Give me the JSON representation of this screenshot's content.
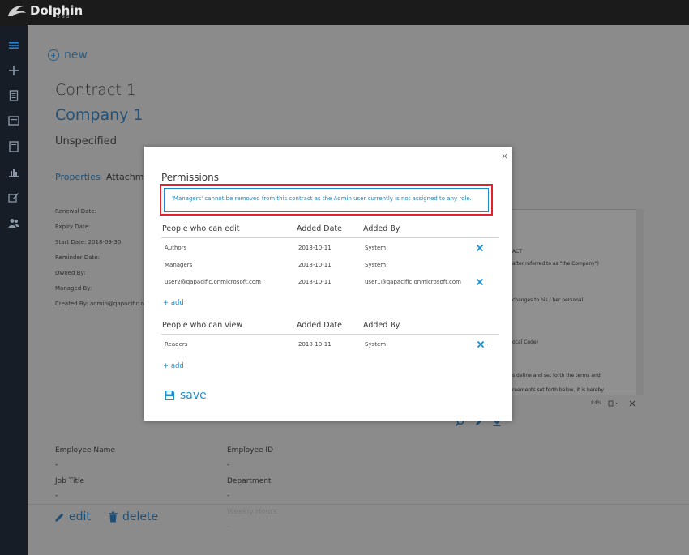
{
  "app": {
    "name": "Dolphin",
    "sub": "365"
  },
  "sidebar": {
    "icons": [
      "menu-icon",
      "plus-icon",
      "document-icon",
      "inbox-icon",
      "report-icon",
      "chart-icon",
      "edit-icon",
      "users-icon"
    ]
  },
  "page": {
    "new_label": "new",
    "contract_title": "Contract 1",
    "company": "Company 1",
    "status": "Unspecified",
    "tabs": [
      "Properties",
      "Attachments"
    ],
    "meta": [
      "Renewal Date:",
      "Expiry Date:",
      "Start Date: 2018-09-30",
      "Reminder Date:",
      "Owned By:",
      "Managed By:",
      "Created By: admin@qapacific.onmicrosoft.com"
    ],
    "doc_lines": [
      "ACT",
      "after referred to as \"the Company\")",
      "changes to his / her personal",
      "ocal Code)",
      "s define and set forth the terms and",
      "reements set forth below, it is hereby"
    ],
    "doc_zoom": "84%",
    "fields": {
      "employee_name": "Employee Name",
      "employee_name_val": "-",
      "employee_id": "Employee ID",
      "employee_id_val": "-",
      "job_title": "Job Title",
      "job_title_val": "-",
      "department": "Department",
      "department_val": "-",
      "hidden_label": "Weekly Hours",
      "hidden_val": "-"
    },
    "edit_label": "edit",
    "delete_label": "delete"
  },
  "modal": {
    "close": "×",
    "title": "Permissions",
    "warning": "'Managers' cannot be removed from this contract as the Admin user currently is not assigned to any role.",
    "edit_section": {
      "header": "People who can edit",
      "col_date": "Added Date",
      "col_by": "Added By",
      "rows": [
        {
          "name": "Authors",
          "date": "2018-10-11",
          "by": "System",
          "removable": true
        },
        {
          "name": "Managers",
          "date": "2018-10-11",
          "by": "System",
          "removable": false
        },
        {
          "name": "user2@qapacific.onmicrosoft.com",
          "date": "2018-10-11",
          "by": "user1@qapacific.onmicrosoft.com",
          "removable": true
        }
      ],
      "add": "+ add"
    },
    "view_section": {
      "header": "People who can view",
      "col_date": "Added Date",
      "col_by": "Added By",
      "rows": [
        {
          "name": "Readers",
          "date": "2018-10-11",
          "by": "System",
          "removable": true
        }
      ],
      "add": "+ add",
      "dash": "--"
    },
    "save_label": "save"
  },
  "colors": {
    "accent": "#1d8fcf",
    "warning_border": "#e3222b",
    "sidebar": "#161d26",
    "topbar": "#1b1b1b"
  }
}
